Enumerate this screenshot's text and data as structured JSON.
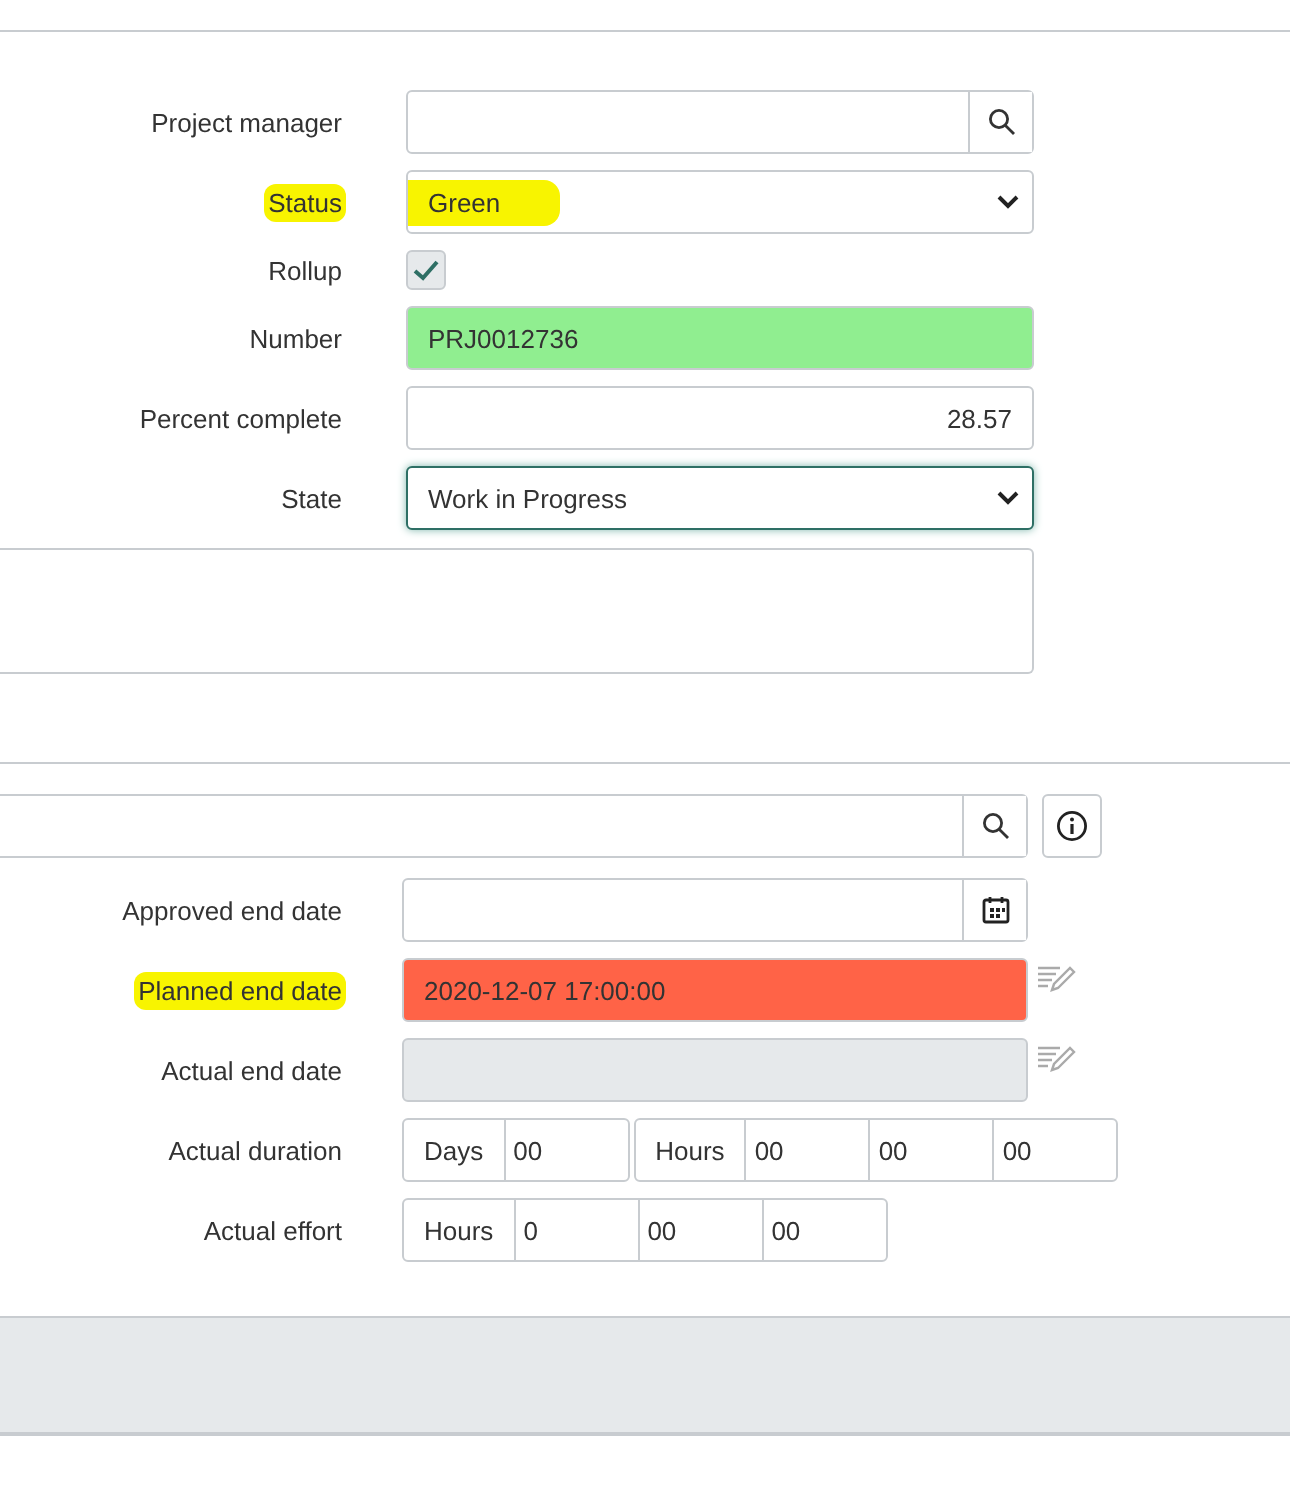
{
  "section_1": {
    "fields": [
      {
        "kind": "reference",
        "label": "Project manager",
        "highlighted": false
      },
      {
        "kind": "select",
        "label": "Status",
        "value": "Green",
        "highlighted": true
      },
      {
        "kind": "checkbox",
        "label": "Rollup",
        "checked": true,
        "highlighted": false
      },
      {
        "kind": "text",
        "label": "Number",
        "value": "PRJ0012736",
        "color": "#90ee90",
        "highlighted": false
      },
      {
        "kind": "number",
        "label": "Percent complete",
        "value": "28.57",
        "highlighted": false
      },
      {
        "kind": "select",
        "label": "State",
        "value": "Work in Progress",
        "focused": true,
        "highlighted": false
      }
    ]
  },
  "section_2": {
    "fields": [
      {
        "kind": "date",
        "label": "Approved end date",
        "highlighted": false
      },
      {
        "kind": "date_edit",
        "label": "Planned end date",
        "value": "2020-12-07 17:00:00",
        "color": "#ff6347",
        "highlighted": true
      },
      {
        "kind": "date_edit",
        "label": "Actual end date",
        "color": "#e6e9eb",
        "highlighted": false
      },
      {
        "kind": "duration",
        "label": "Actual duration",
        "groups": [
          {
            "unit": "Days",
            "values": [
              "00"
            ]
          },
          {
            "unit": "Hours",
            "values": [
              "00",
              "00",
              "00"
            ]
          }
        ],
        "highlighted": false
      },
      {
        "kind": "duration",
        "label": "Actual effort",
        "groups": [
          {
            "unit": "Hours",
            "values": [
              "0",
              "00",
              "00"
            ]
          }
        ],
        "highlighted": false
      }
    ]
  }
}
